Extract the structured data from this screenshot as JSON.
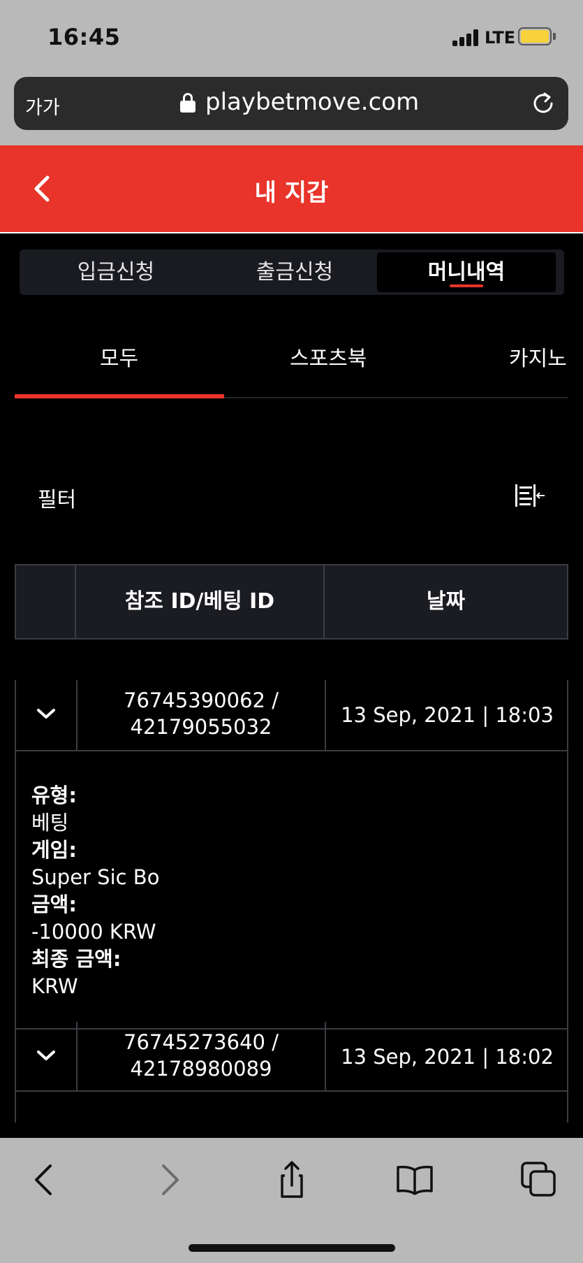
{
  "status_bar": {
    "time": "16:45",
    "network": "LTE"
  },
  "browser": {
    "reader_label": "가가",
    "url": "playbetmove.com"
  },
  "header": {
    "title": "내 지갑"
  },
  "segments": [
    {
      "label": "입금신청",
      "active": false
    },
    {
      "label": "출금신청",
      "active": false
    },
    {
      "label": "머니내역",
      "active": true
    }
  ],
  "categories": [
    {
      "label": "모두",
      "active": true
    },
    {
      "label": "스포츠북",
      "active": false
    },
    {
      "label": "카지노",
      "active": false
    }
  ],
  "filter": {
    "label": "필터"
  },
  "table": {
    "headers": {
      "ref": "참조 ID/베팅 ID",
      "date": "날짜"
    },
    "rows": [
      {
        "ref_line1": "76745390062 /",
        "ref_line2": "42179055032",
        "date": "13 Sep, 2021 | 18:03",
        "expanded": true,
        "details": {
          "type_label": "유형:",
          "type_value": "베팅",
          "game_label": "게임:",
          "game_value": "Super Sic Bo",
          "amount_label": "금액:",
          "amount_value": "-10000 KRW",
          "final_label": "최종 금액:",
          "final_value": "KRW"
        }
      },
      {
        "ref_line1": "76745273640 /",
        "ref_line2": "42178980089",
        "date": "13 Sep, 2021 | 18:02",
        "expanded": false
      }
    ]
  },
  "colors": {
    "accent": "#e8342a",
    "background": "#000000",
    "battery": "#f7d23b"
  },
  "icons": [
    "lock-icon",
    "reload-icon",
    "back-icon",
    "filter-sort-icon",
    "chevron-down-icon",
    "share-icon",
    "bookmarks-icon",
    "tabs-icon"
  ]
}
